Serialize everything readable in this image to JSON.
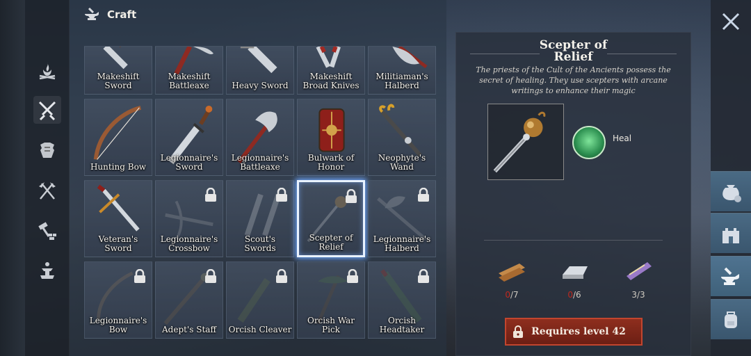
{
  "header": {
    "title": "Craft",
    "icon": "anvil-hammer-icon"
  },
  "sidebar": {
    "items": [
      {
        "name": "campfire",
        "icon": "campfire-icon"
      },
      {
        "name": "weapons",
        "icon": "crossed-swords-icon",
        "active": true
      },
      {
        "name": "armor",
        "icon": "armor-icon"
      },
      {
        "name": "tools",
        "icon": "crossed-axes-icon"
      },
      {
        "name": "building",
        "icon": "hammer-bricks-icon"
      },
      {
        "name": "decor",
        "icon": "fountain-icon"
      }
    ]
  },
  "grid": {
    "items": [
      {
        "label": "Makeshift Sword",
        "locked": false
      },
      {
        "label": "Makeshift Battleaxe",
        "locked": false
      },
      {
        "label": "Heavy Sword",
        "locked": false
      },
      {
        "label": "Makeshift Broad Knives",
        "locked": false
      },
      {
        "label": "Militiaman's Halberd",
        "locked": false
      },
      {
        "label": "Hunting Bow",
        "locked": false
      },
      {
        "label": "Legionnaire's Sword",
        "locked": false
      },
      {
        "label": "Legionnaire's Battleaxe",
        "locked": false
      },
      {
        "label": "Bulwark of Honor",
        "locked": false
      },
      {
        "label": "Neophyte's Wand",
        "locked": false
      },
      {
        "label": "Veteran's Sword",
        "locked": false
      },
      {
        "label": "Legionnaire's Crossbow",
        "locked": true
      },
      {
        "label": "Scout's Swords",
        "locked": true
      },
      {
        "label": "Scepter of Relief",
        "locked": true,
        "selected": true
      },
      {
        "label": "Legionnaire's Halberd",
        "locked": true
      },
      {
        "label": "Legionnaire's Bow",
        "locked": true
      },
      {
        "label": "Adept's Staff",
        "locked": true
      },
      {
        "label": "Orcish Cleaver",
        "locked": true
      },
      {
        "label": "Orcish War Pick",
        "locked": true
      },
      {
        "label": "Orcish Headtaker",
        "locked": true
      }
    ]
  },
  "detail": {
    "title": "Scepter of\nRelief",
    "description": "The priests of the Cult of the Ancients possess the secret of healing. They use scepters with arcane writings to enhance their magic",
    "skill": {
      "name": "Heal",
      "icon": "heal-skill-icon"
    },
    "materials": [
      {
        "icon": "wood-planks-icon",
        "have": "0",
        "need": "/7",
        "short": true
      },
      {
        "icon": "iron-ingot-icon",
        "have": "0",
        "need": "/6",
        "short": true
      },
      {
        "icon": "scroll-icon",
        "have": "3",
        "need": "/3",
        "short": false
      }
    ],
    "requirement_label": "Requires level 42"
  },
  "rail": {
    "close_icon": "close-icon",
    "buttons": [
      {
        "icon": "coin-bag-icon"
      },
      {
        "icon": "castle-icon"
      },
      {
        "icon": "anvil-hammer-icon",
        "active": true
      },
      {
        "icon": "backpack-icon"
      }
    ]
  },
  "colors": {
    "accent_red": "#8e2e1e",
    "selected_glow": "#6fa8ff",
    "shortage": "#c0281e"
  }
}
